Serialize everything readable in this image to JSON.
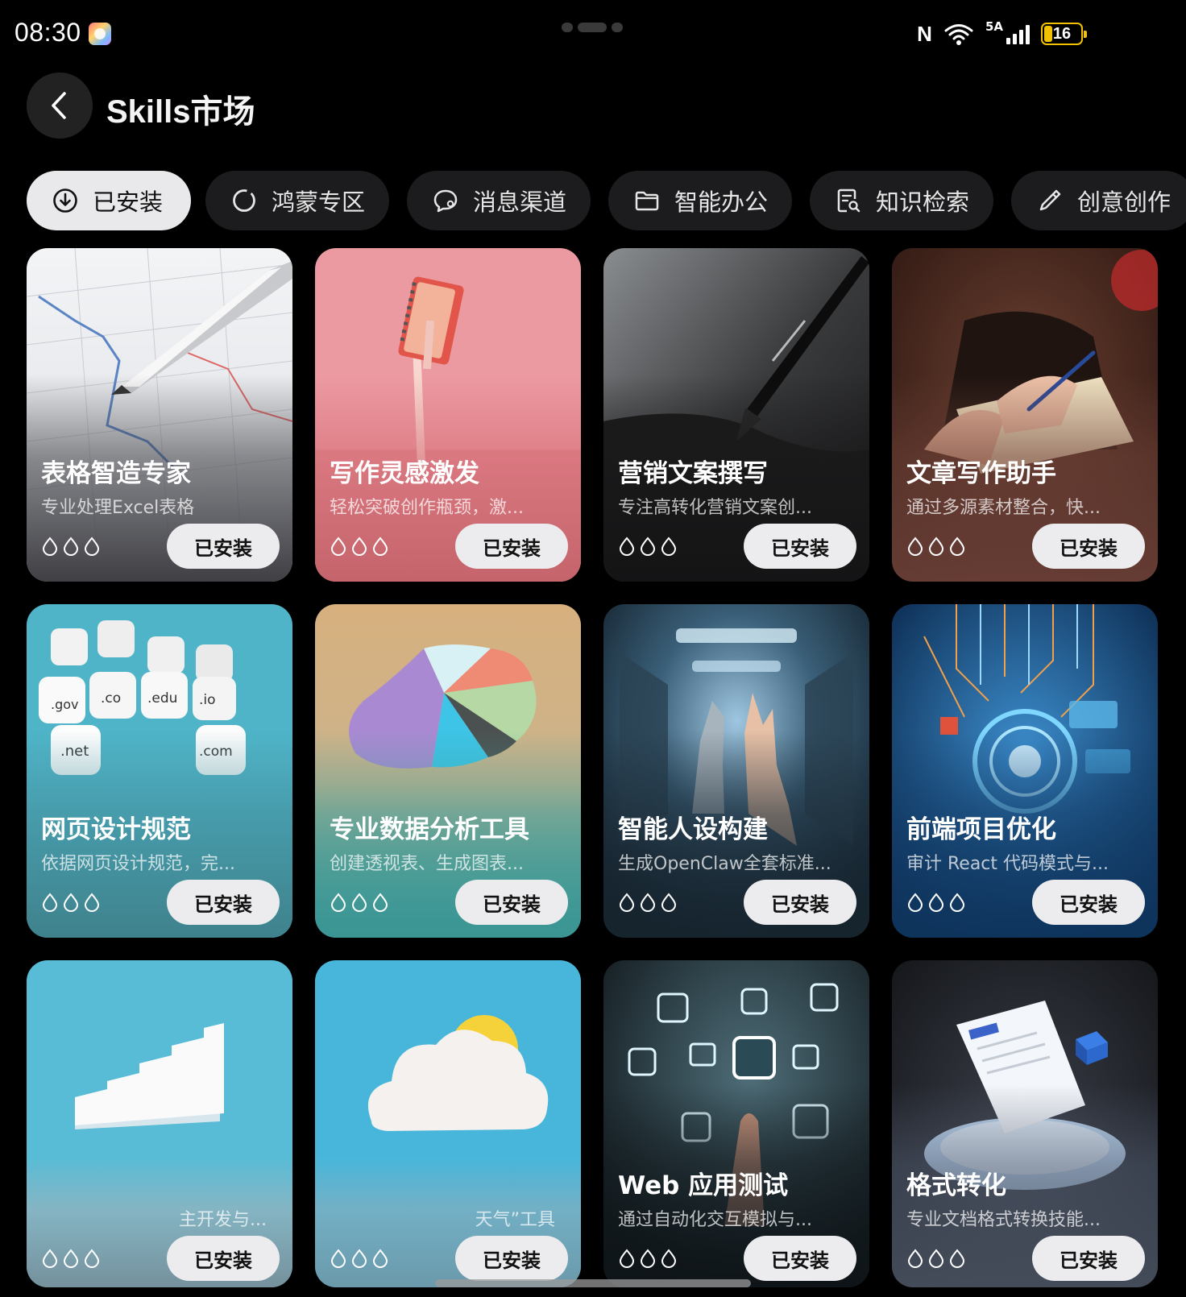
{
  "status_bar": {
    "time": "08:30",
    "network": "5A",
    "battery": "16"
  },
  "header": {
    "title": "Skills市场"
  },
  "tabs": [
    {
      "label": "已安装",
      "icon": "download-circle-icon",
      "active": true
    },
    {
      "label": "鸿蒙专区",
      "icon": "ring-icon",
      "active": false
    },
    {
      "label": "消息渠道",
      "icon": "chat-bubble-icon",
      "active": false
    },
    {
      "label": "智能办公",
      "icon": "folder-icon",
      "active": false
    },
    {
      "label": "知识检索",
      "icon": "document-search-icon",
      "active": false
    },
    {
      "label": "创意创作",
      "icon": "pen-icon",
      "active": false
    }
  ],
  "cards": [
    {
      "title": "表格智造专家",
      "desc": "专业处理Excel表格",
      "button": "已安装",
      "image": "pen-on-chart"
    },
    {
      "title": "写作灵感激发",
      "desc": "轻松突破创作瓶颈，激...",
      "button": "已安装",
      "image": "notebook-on-pink"
    },
    {
      "title": "营销文案撰写",
      "desc": "专注高转化营销文案创...",
      "button": "已安装",
      "image": "fountain-pen-dark"
    },
    {
      "title": "文章写作助手",
      "desc": "通过多源素材整合，快...",
      "button": "已安装",
      "image": "hand-writing-notebook"
    },
    {
      "title": "网页设计规范",
      "desc": "依据网页设计规范，完...",
      "button": "已安装",
      "image": "domain-dice"
    },
    {
      "title": "专业数据分析工具",
      "desc": "创建透视表、生成图表...",
      "button": "已安装",
      "image": "3d-pie-chart"
    },
    {
      "title": "智能人设构建",
      "desc": "生成OpenClaw全套标准...",
      "button": "已安装",
      "image": "robot-human-hands"
    },
    {
      "title": "前端项目优化",
      "desc": "审计 React 代码模式与...",
      "button": "已安装",
      "image": "circuit-board"
    },
    {
      "title": "",
      "desc": "主开发与...",
      "button": "已安装",
      "image": "white-stairs"
    },
    {
      "title": "",
      "desc": "天气”工具",
      "button": "已安装",
      "image": "cloud-sun"
    },
    {
      "title": "Web 应用测试",
      "desc": "通过自动化交互模拟与...",
      "button": "已安装",
      "image": "floating-app-icons"
    },
    {
      "title": "格式转化",
      "desc": "专业文档格式转换技能...",
      "button": "已安装",
      "image": "document-on-platform"
    }
  ],
  "colors": {
    "background": "#000000",
    "tab_active": "#e9e9eb",
    "tab_inactive": "#1c1c1e",
    "button": "#ececee",
    "battery": "#f2c200"
  }
}
